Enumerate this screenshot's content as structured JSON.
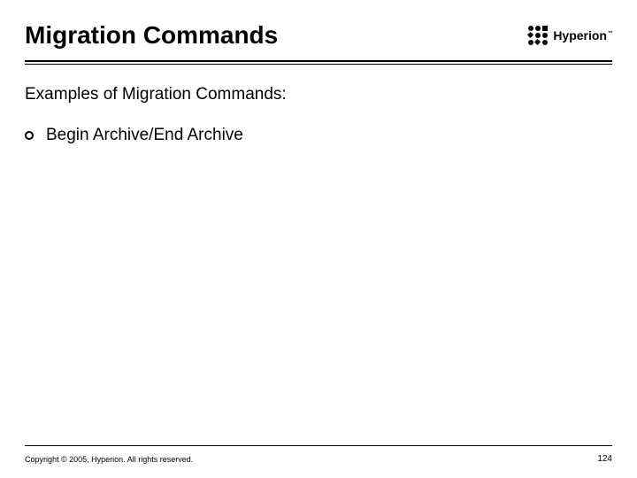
{
  "header": {
    "title": "Migration Commands",
    "brand_name": "Hyperion",
    "brand_tm": "™"
  },
  "body": {
    "subtitle": "Examples of Migration Commands:",
    "bullets": [
      {
        "text": "Begin Archive/End Archive"
      }
    ]
  },
  "footer": {
    "copyright": "Copyright © 2005, Hyperion. All rights reserved.",
    "page_number": "124"
  }
}
